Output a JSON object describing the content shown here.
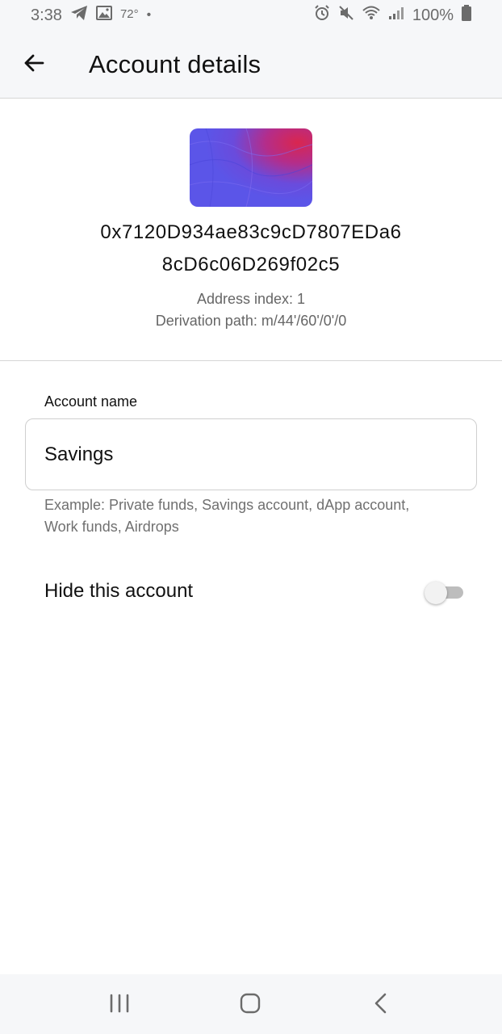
{
  "status_bar": {
    "time": "3:38",
    "temperature": "72°",
    "dot": "•",
    "battery": "100%",
    "icons_left": [
      "telegram-icon",
      "image-icon"
    ],
    "icons_right": [
      "alarm-icon",
      "mute-icon",
      "wifi-icon",
      "signal-icon",
      "battery-icon"
    ]
  },
  "app_bar": {
    "title": "Account details",
    "back_icon": "arrow-left-icon"
  },
  "account": {
    "address_line1": "0x7120D934ae83c9cD7807EDa6",
    "address_line2": "8cD6c06D269f02c5",
    "address_index": "Address index: 1",
    "derivation_path": "Derivation path: m/44'/60'/0'/0",
    "avatar_colors": [
      "#5b55e8",
      "#d9264f"
    ]
  },
  "form": {
    "account_name_label": "Account name",
    "account_name_value": "Savings",
    "helper_text": "Example: Private funds, Savings account, dApp account, Work funds, Airdrops"
  },
  "hide_toggle": {
    "label": "Hide this account",
    "enabled": false
  },
  "nav_bar": {
    "recents_icon": "recents-icon",
    "home_icon": "home-icon",
    "back_icon": "back-chevron-icon"
  }
}
